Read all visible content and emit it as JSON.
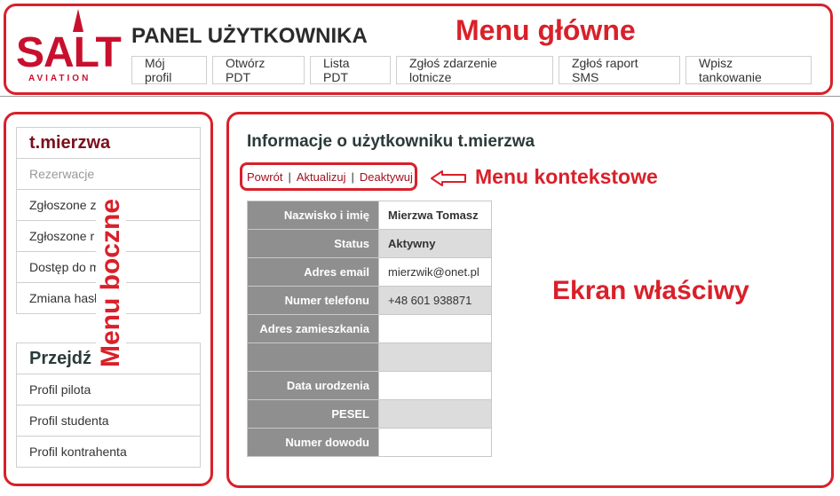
{
  "annotations": {
    "main_menu": "Menu główne",
    "side_menu": "Menu boczne",
    "context_menu": "Menu kontekstowe",
    "main_screen": "Ekran właściwy",
    "color": "#d9202a"
  },
  "logo": {
    "text": "SALT",
    "subtitle": "AVIATION",
    "color": "#c8102e"
  },
  "header": {
    "title": "PANEL UŻYTKOWNIKA",
    "nav": [
      "Mój profil",
      "Otwórz PDT",
      "Lista PDT",
      "Zgłoś zdarzenie lotnicze",
      "Zgłoś raport SMS",
      "Wpisz tankowanie"
    ]
  },
  "sidebar": {
    "user": {
      "heading": "t.mierzwa",
      "items": [
        "Rezerwacje",
        "Zgłoszone z",
        "Zgłoszone r",
        "Dostęp do m",
        "Zmiana hasł"
      ]
    },
    "goto": {
      "heading": "Przejdź",
      "items": [
        "Profil pilota",
        "Profil studenta",
        "Profil kontrahenta"
      ]
    }
  },
  "main": {
    "title": "Informacje o użytkowniku t.mierzwa",
    "context_menu": [
      "Powrót",
      "Aktualizuj",
      "Deaktywuj"
    ],
    "fields": [
      {
        "label": "Nazwisko i imię",
        "value": "Mierzwa Tomasz"
      },
      {
        "label": "Status",
        "value": "Aktywny"
      },
      {
        "label": "Adres email",
        "value": "mierzwik@onet.pl"
      },
      {
        "label": "Numer telefonu",
        "value": "+48 601 938871"
      },
      {
        "label": "Adres zamieszkania",
        "value": ""
      },
      {
        "label": "",
        "value": ""
      },
      {
        "label": "Data urodzenia",
        "value": ""
      },
      {
        "label": "PESEL",
        "value": ""
      },
      {
        "label": "Numer dowodu",
        "value": ""
      }
    ]
  }
}
